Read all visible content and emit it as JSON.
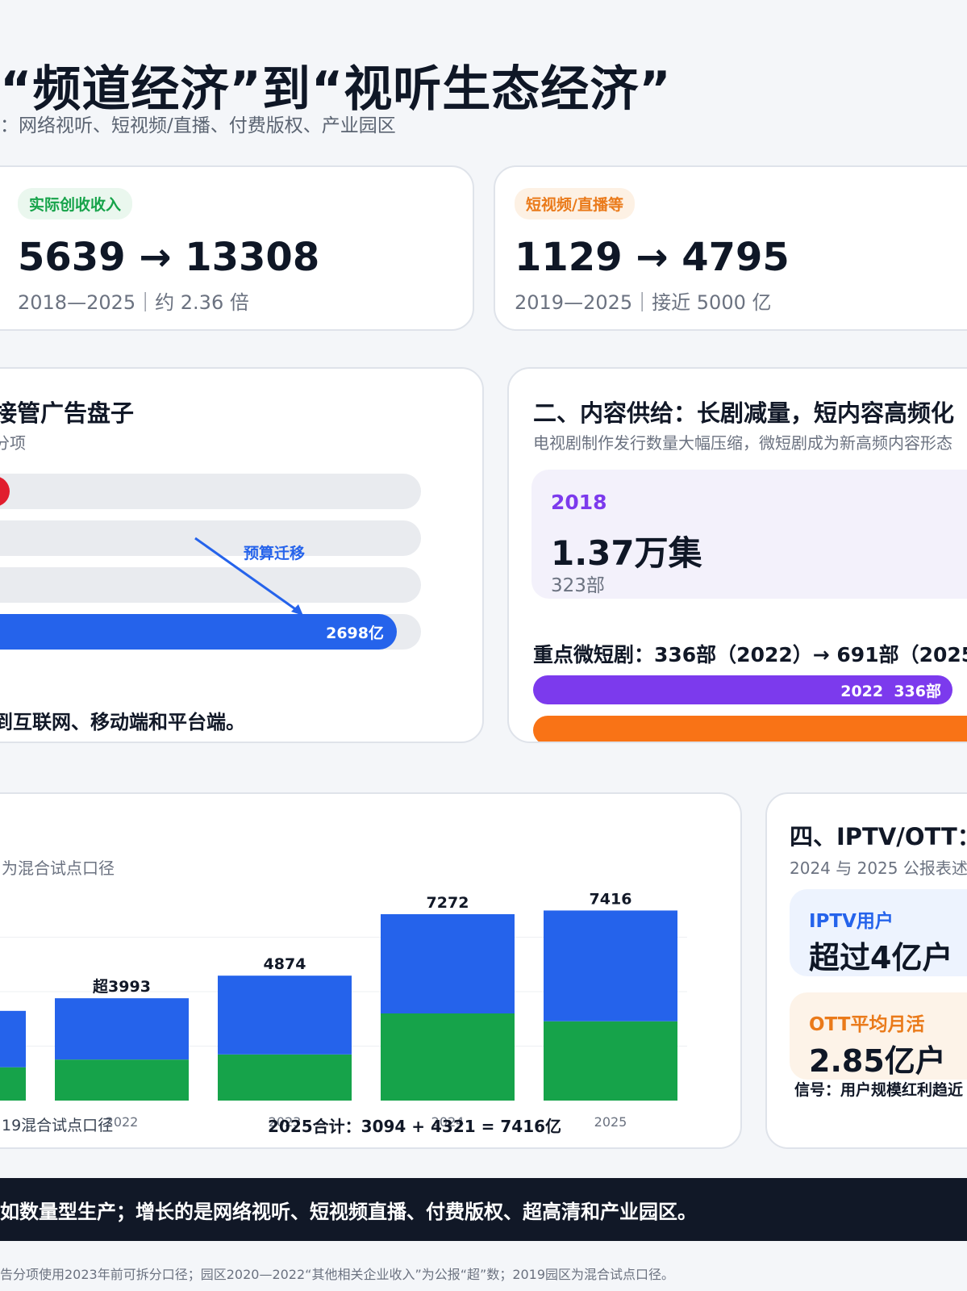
{
  "header": {
    "title": "“频道经济”到“视听生态经济”",
    "subtitle": "：网络视听、短视频/直播、付费版权、产业园区"
  },
  "stat_cards": [
    {
      "tag": "实际创收收入",
      "tag_color": "#16a34a",
      "tag_bg": "#eaf7ee",
      "value": "5639 → 13308",
      "detail": "2018—2025｜约 2.36 倍"
    },
    {
      "tag": "短视频/直播等",
      "tag_color": "#ea7a1a",
      "tag_bg": "#fdf1e4",
      "value": "1129 → 4795",
      "detail": "2019—2025｜接近 5000 亿"
    }
  ],
  "ad_section": {
    "title": "接管广告盘子",
    "subtitle": "分项",
    "arrow_label": "预算迁移",
    "bar_value_label": "2698亿",
    "bar_fill_fraction": 0.93,
    "footer_text": "到互联网、移动端和平台端。"
  },
  "content_section": {
    "title": "二、内容供给：长剧减量，短内容高频化",
    "subtitle": "电视剧制作发行数量大幅压缩，微短剧成为新高频内容形态",
    "year": "2018",
    "episodes": "1.37万集",
    "parts": "323部",
    "micro_drama_text": "重点微短剧：336部（2022）→ 691部（2025）",
    "bar_2022_label": "2022  336部",
    "bar_2022_value": 336,
    "bar_2025_value": 691
  },
  "park_section": {
    "subtitle": "为混合试点口径",
    "footnote_left": "19混合试点口径",
    "total_note": "2025合计：3094 + 4321 = 7416亿"
  },
  "chart_data": {
    "type": "bar",
    "stacked": true,
    "categories": [
      "2021",
      "2022",
      "2023",
      "2024",
      "2025"
    ],
    "tick_labels": [
      "",
      "2022",
      "2023",
      "2024",
      "2025"
    ],
    "value_labels": [
      "",
      "超3993",
      "4874",
      "7272",
      "7416"
    ],
    "series": [
      {
        "color": "#16a34a",
        "values": [
          1300,
          1600,
          1800,
          3400,
          3094
        ]
      },
      {
        "color": "#2563eb",
        "values": [
          2200,
          2393,
          3074,
          3872,
          4322
        ]
      }
    ],
    "ylim": [
      0,
      8500
    ],
    "grid": true
  },
  "iptv_section": {
    "title": "四、IPTV/OTT：",
    "subtitle": "2024 与 2025 公报表述完",
    "iptv_label": "IPTV用户",
    "iptv_value": "超过4亿户",
    "ott_label": "OTT平均月活",
    "ott_value": "2.85亿户",
    "signal_text": "信号：用户规模红利趋近"
  },
  "footer": {
    "band_text": "如数量型生产；增长的是网络视听、短视频直播、付费版权、超高清和产业园区。",
    "note": "告分项使用2023年前可拆分口径；园区2020—2022“其他相关企业收入”为公报“超”数；2019园区为混合试点口径。"
  }
}
